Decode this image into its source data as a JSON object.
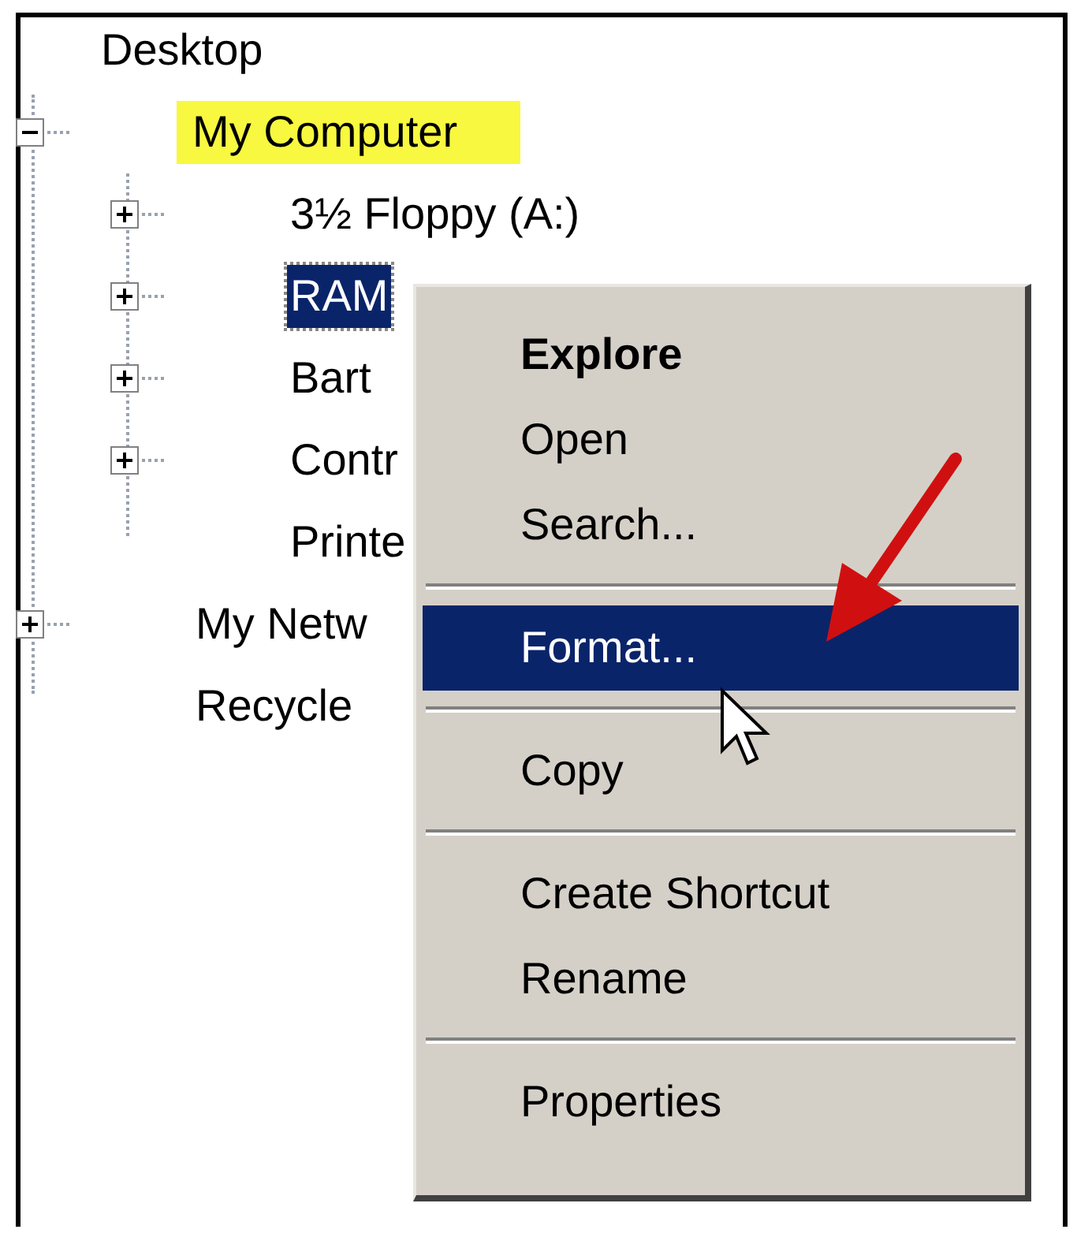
{
  "tree": [
    {
      "label": "Desktop",
      "selected": false,
      "highlighted": false,
      "children": [
        {
          "label": "My Computer",
          "expanded": true,
          "selected": false,
          "highlighted": true,
          "children": [
            {
              "label": "3½ Floppy (A:)",
              "expanded": false,
              "selected": false,
              "highlighted": false
            },
            {
              "label": "RAM",
              "expanded": false,
              "selected": true,
              "highlighted": false
            },
            {
              "label": "Bart",
              "expanded": false,
              "selected": false,
              "highlighted": false
            },
            {
              "label": "Contr",
              "expanded": false,
              "selected": false,
              "highlighted": false
            },
            {
              "label": "Printe",
              "selected": false,
              "highlighted": false
            }
          ]
        },
        {
          "label": "My Netw",
          "expanded": false,
          "selected": false,
          "highlighted": false
        },
        {
          "label": "Recycle",
          "selected": false,
          "highlighted": false
        }
      ]
    }
  ],
  "context_menu": [
    {
      "kind": "item",
      "label": "Explore",
      "default": true,
      "selected": false
    },
    {
      "kind": "item",
      "label": "Open",
      "default": false,
      "selected": false
    },
    {
      "kind": "item",
      "label": "Search...",
      "default": false,
      "selected": false
    },
    {
      "kind": "separator"
    },
    {
      "kind": "item",
      "label": "Format...",
      "default": false,
      "selected": true
    },
    {
      "kind": "separator"
    },
    {
      "kind": "item",
      "label": "Copy",
      "default": false,
      "selected": false
    },
    {
      "kind": "separator"
    },
    {
      "kind": "item",
      "label": "Create Shortcut",
      "default": false,
      "selected": false
    },
    {
      "kind": "item",
      "label": "Rename",
      "default": false,
      "selected": false
    },
    {
      "kind": "separator"
    },
    {
      "kind": "item",
      "label": "Properties",
      "default": false,
      "selected": false
    }
  ]
}
